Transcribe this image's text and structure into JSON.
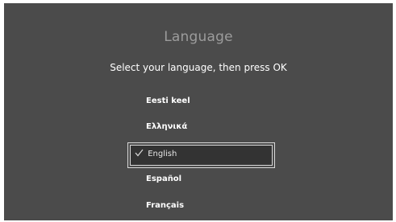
{
  "screen": {
    "title": "Language",
    "instruction": "Select your language, then press OK"
  },
  "languages": [
    {
      "label": "Eesti keel",
      "selected": false
    },
    {
      "label": "Ελληνικά",
      "selected": false
    },
    {
      "label": "English",
      "selected": true
    },
    {
      "label": "Español",
      "selected": false
    },
    {
      "label": "Français",
      "selected": false
    }
  ],
  "icons": {
    "selected_marker": "check-icon"
  },
  "colors": {
    "background": "#4b4b4b",
    "title": "#9c9c9c",
    "text": "#ffffff",
    "selection_fill": "#333333",
    "selection_border": "#d8d8d8"
  }
}
